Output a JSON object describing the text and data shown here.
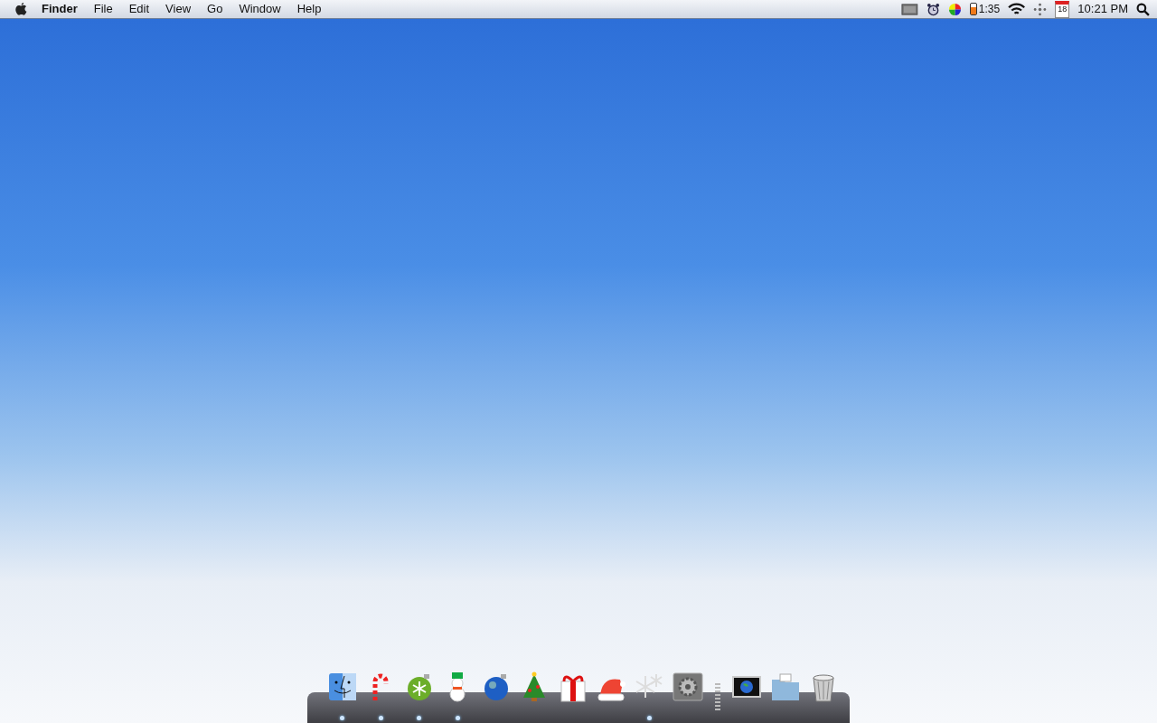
{
  "menu_bar": {
    "app_name": "Finder",
    "menus": [
      "File",
      "Edit",
      "View",
      "Go",
      "Window",
      "Help"
    ],
    "battery": {
      "time": "1:35",
      "level": 0.7
    },
    "calendar_day": "18",
    "clock": "10:21 PM"
  },
  "dock": {
    "items": [
      {
        "running": true
      },
      {
        "running": true
      },
      {
        "running": true
      },
      {
        "running": true
      },
      {
        "running": false
      },
      {
        "running": false
      },
      {
        "running": false
      },
      {
        "running": false
      },
      {
        "running": true
      },
      {
        "running": false
      },
      {
        "running": false
      },
      {
        "running": false
      },
      {
        "running": false
      }
    ]
  }
}
